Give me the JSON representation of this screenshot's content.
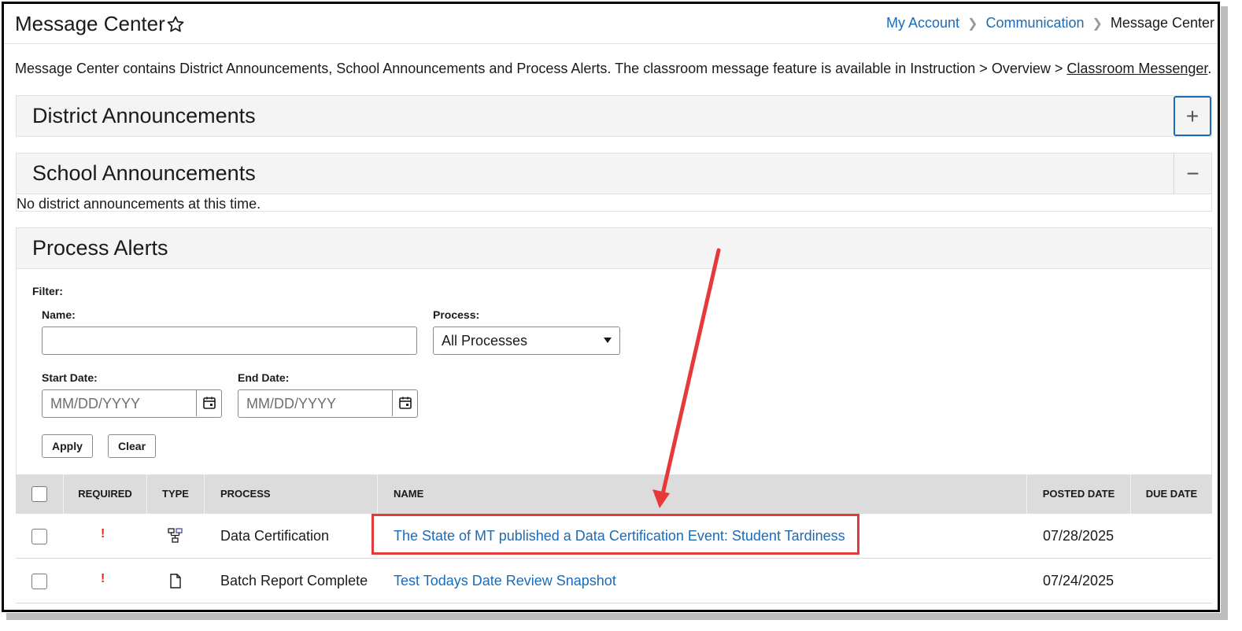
{
  "header": {
    "title": "Message Center",
    "breadcrumb": [
      "My Account",
      "Communication",
      "Message Center"
    ]
  },
  "intro": {
    "text": "Message Center contains District Announcements, School Announcements and Process Alerts. The classroom message feature is available in Instruction > Overview > ",
    "link": "Classroom Messenger",
    "end": "."
  },
  "panels": {
    "district": {
      "title": "District Announcements",
      "toggle": "+"
    },
    "school": {
      "title": "School Announcements",
      "toggle": "−",
      "empty_text": "No district announcements at this time."
    },
    "process": {
      "title": "Process Alerts"
    }
  },
  "filter": {
    "heading": "Filter:",
    "name_label": "Name:",
    "name_value": "",
    "process_label": "Process:",
    "process_selected": "All Processes",
    "start_label": "Start Date:",
    "start_placeholder": "MM/DD/YYYY",
    "end_label": "End Date:",
    "end_placeholder": "MM/DD/YYYY",
    "apply": "Apply",
    "clear": "Clear"
  },
  "table": {
    "columns": [
      "REQUIRED",
      "TYPE",
      "PROCESS",
      "NAME",
      "POSTED DATE",
      "DUE DATE"
    ],
    "rows": [
      {
        "required": "!",
        "type_icon": "hierarchy-icon",
        "process": "Data Certification",
        "name": "The State of MT published a Data Certification Event: Student Tardiness",
        "posted": "07/28/2025",
        "due": ""
      },
      {
        "required": "!",
        "type_icon": "document-icon",
        "process": "Batch Report Complete",
        "name": "Test Todays Date Review Snapshot",
        "posted": "07/24/2025",
        "due": ""
      }
    ]
  },
  "colors": {
    "link": "#1a6bb8",
    "annotation": "#e63a3a",
    "required": "#e0281e"
  }
}
